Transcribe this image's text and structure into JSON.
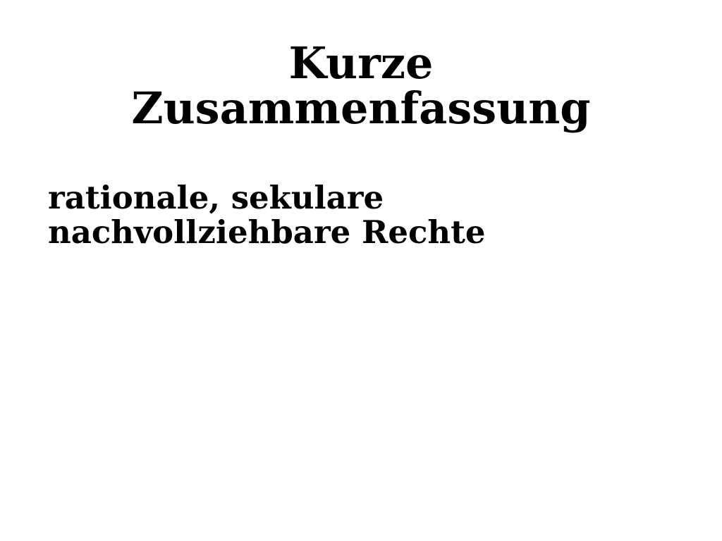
{
  "slide": {
    "title_lines": [
      "Kurze",
      "Zusammenfassung"
    ],
    "body_lines": [
      "rationale, sekulare",
      "nachvollziehbare Rechte"
    ]
  }
}
